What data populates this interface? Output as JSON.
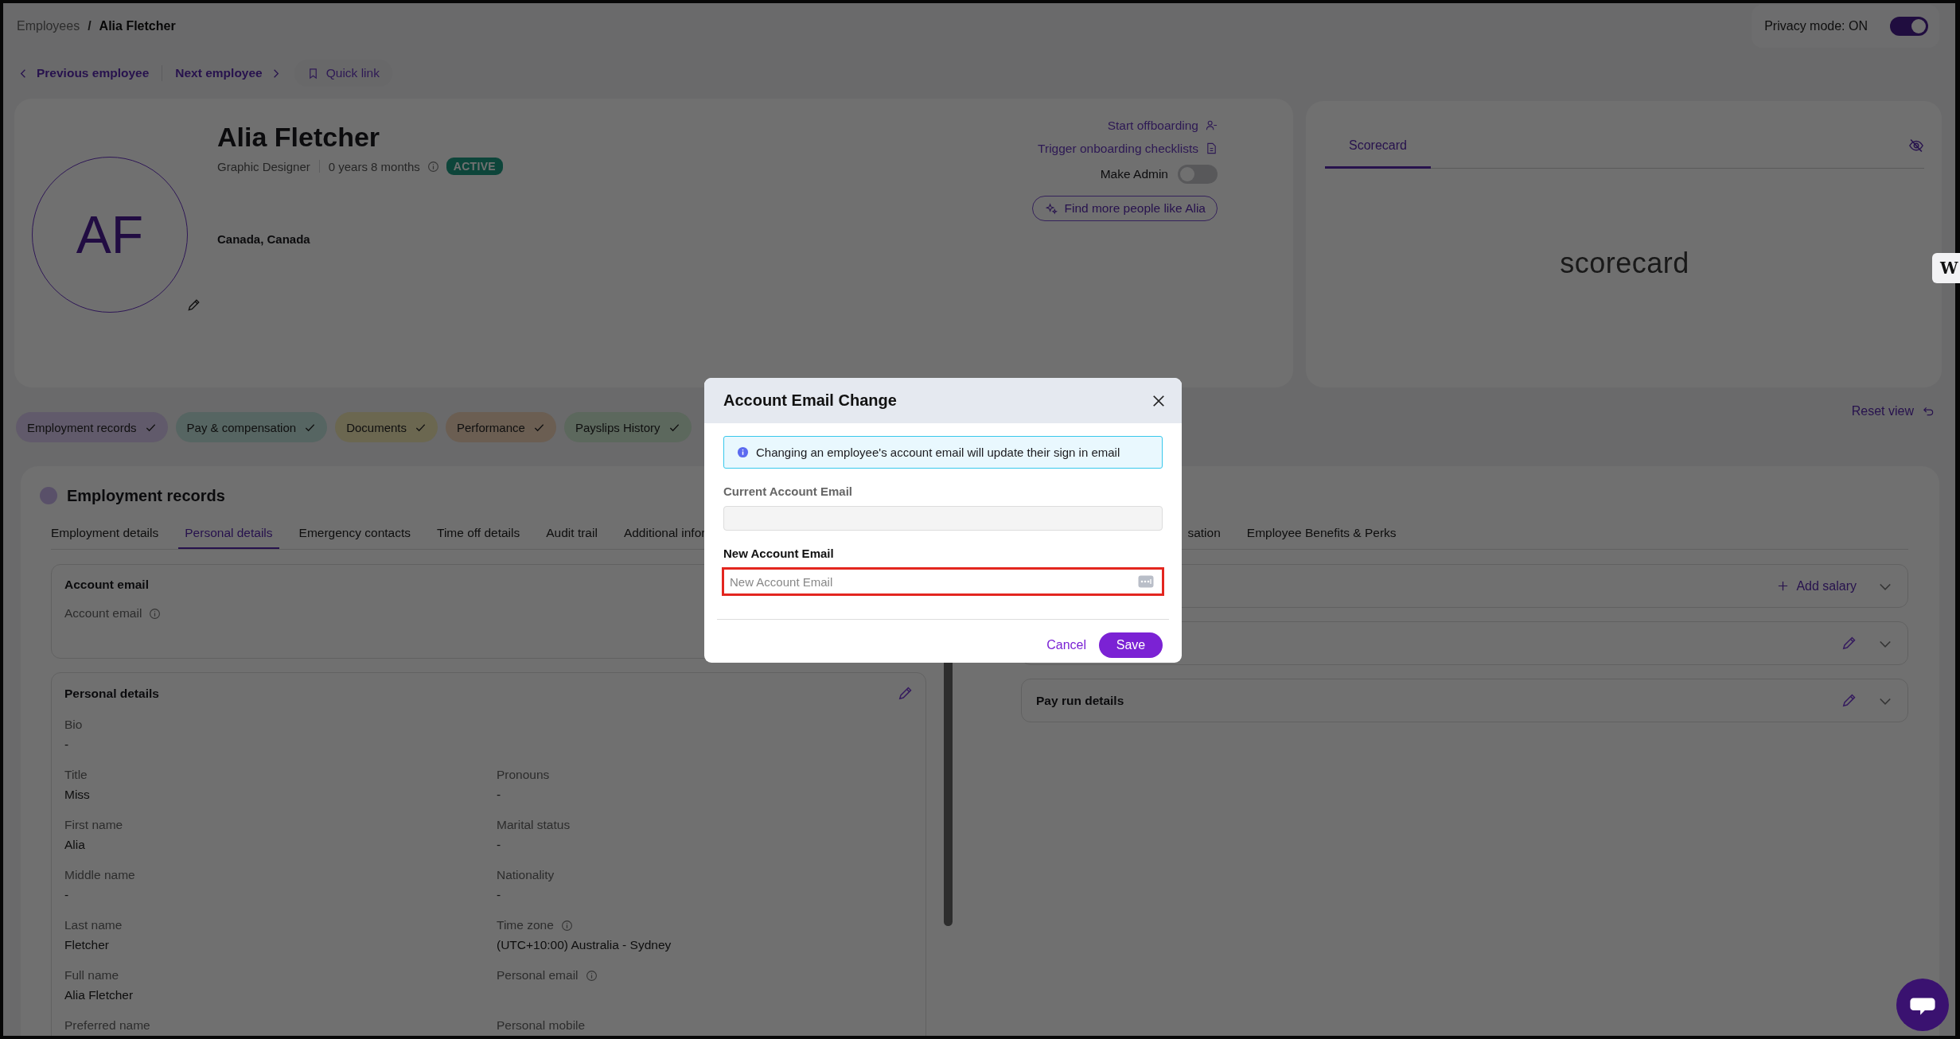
{
  "breadcrumb": {
    "items": [
      {
        "label": "Employees",
        "current": false
      },
      {
        "label": "Alia Fletcher",
        "current": true
      }
    ],
    "separator": "/"
  },
  "privacy_mode": {
    "label": "Privacy mode: ON",
    "on": true
  },
  "employee_nav": {
    "previous": "Previous employee",
    "next": "Next employee",
    "quick_link": "Quick link"
  },
  "profile": {
    "initials": "AF",
    "name": "Alia Fletcher",
    "job_title": "Graphic Designer",
    "tenure": "0 years 8 months",
    "status": "ACTIVE",
    "location": "Canada, Canada"
  },
  "profile_actions": {
    "offboarding": "Start offboarding",
    "onboarding": "Trigger onboarding checklists",
    "make_admin": {
      "label": "Make Admin",
      "on": false
    },
    "find_more": "Find more people like Alia"
  },
  "scorecard": {
    "tabs": [
      {
        "label": "Scorecard",
        "selected": true
      }
    ],
    "body_text": "scorecard"
  },
  "section_pills": [
    {
      "label": "Employment records",
      "color": "#615a6b"
    },
    {
      "label": "Pay & compensation",
      "color": "#566562"
    },
    {
      "label": "Documents",
      "color": "#6b6750"
    },
    {
      "label": "Performance",
      "color": "#6b5e52"
    },
    {
      "label": "Payslips History",
      "color": "#5c685d"
    }
  ],
  "reset_view": "Reset view",
  "records": {
    "title": "Employment records",
    "tabs": [
      {
        "label": "Employment details",
        "selected": false,
        "kind": "full"
      },
      {
        "label": "Personal details",
        "selected": true,
        "kind": "full"
      },
      {
        "label": "Emergency contacts",
        "selected": false,
        "kind": "full"
      },
      {
        "label": "Time off details",
        "selected": false,
        "kind": "full"
      },
      {
        "label": "Audit trail",
        "selected": false,
        "kind": "full"
      },
      {
        "label": "Additional infor",
        "selected": false,
        "kind": "full"
      },
      {
        "label": "sation",
        "selected": false,
        "kind": "clipped"
      },
      {
        "label": "Employee Benefits & Perks",
        "selected": false,
        "kind": "full"
      }
    ],
    "account_email": {
      "title": "Account email",
      "label": "Account email"
    },
    "personal_details": {
      "title": "Personal details",
      "fields": [
        {
          "label": "Bio",
          "value": "-",
          "kind": "wide",
          "info": false
        },
        {
          "label": "Title",
          "value": "Miss",
          "kind": "half",
          "info": false
        },
        {
          "label": "Pronouns",
          "value": "-",
          "kind": "half",
          "info": false
        },
        {
          "label": "First name",
          "value": "Alia",
          "kind": "half",
          "info": false
        },
        {
          "label": "Marital status",
          "value": "-",
          "kind": "half",
          "info": false
        },
        {
          "label": "Middle name",
          "value": "-",
          "kind": "half",
          "info": false
        },
        {
          "label": "Nationality",
          "value": "-",
          "kind": "half",
          "info": false
        },
        {
          "label": "Last name",
          "value": "Fletcher",
          "kind": "half",
          "info": false
        },
        {
          "label": "Time zone",
          "value": "(UTC+10:00) Australia - Sydney",
          "kind": "half",
          "info": true
        },
        {
          "label": "Full name",
          "value": "Alia Fletcher",
          "kind": "half",
          "info": false
        },
        {
          "label": "Personal email",
          "kind": "half",
          "info": true
        },
        {
          "label": "Preferred name",
          "kind": "half",
          "info": false
        },
        {
          "label": "Personal mobile",
          "kind": "half",
          "info": false
        }
      ]
    },
    "right_panels": [
      {
        "kind": "add",
        "action": "Add salary"
      },
      {
        "kind": "edit"
      },
      {
        "kind": "edit",
        "title": "Pay run details"
      }
    ]
  },
  "modal": {
    "title": "Account Email Change",
    "notice": "Changing an employee's account email will update their sign in email",
    "current_label": "Current Account Email",
    "new_label": "New Account Email",
    "new_placeholder": "New Account Email",
    "cancel": "Cancel",
    "save": "Save"
  },
  "side_widget": {
    "label": "W"
  }
}
